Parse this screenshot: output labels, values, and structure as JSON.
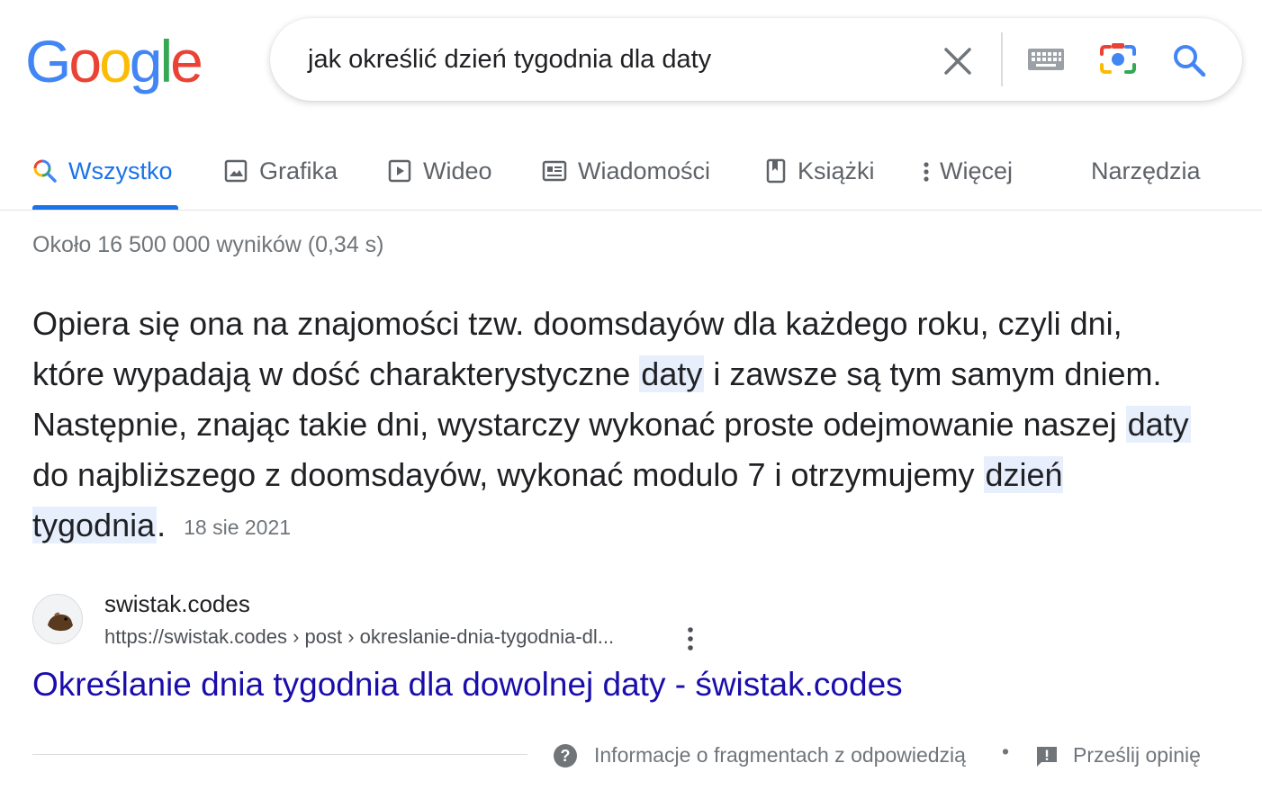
{
  "logo": {
    "letters": [
      "G",
      "o",
      "o",
      "g",
      "l",
      "e"
    ],
    "colors": [
      "#4285f4",
      "#ea4335",
      "#fbbc05",
      "#4285f4",
      "#34a853",
      "#ea4335"
    ]
  },
  "search": {
    "query": "jak określić dzień tygodnia dla daty"
  },
  "tabs": {
    "all": "Wszystko",
    "images": "Grafika",
    "video": "Wideo",
    "news": "Wiadomości",
    "books": "Książki",
    "more": "Więcej",
    "tools": "Narzędzia"
  },
  "colors": {
    "accent": "#1a73e8",
    "link": "#1a0dab",
    "highlight": "#e7effd"
  },
  "stats": "Około 16 500 000 wyników (0,34 s)",
  "snippet": {
    "p1": "Opiera się ona na znajomości tzw. doomsdayów dla każdego roku, czyli dni, które wypadają w dość charakterystyczne ",
    "h1": "daty",
    "p2": " i zawsze są tym samym dniem. Następnie, znając takie dni, wystarczy wykonać proste odejmowanie naszej ",
    "h2": "daty",
    "p3": " do najbliższego z doomsdayów, wykonać modulo 7 i otrzymujemy ",
    "h3": "dzień tygodnia",
    "p4": ".",
    "date": "18 sie 2021"
  },
  "result": {
    "site_name": "swistak.codes",
    "url": "https://swistak.codes › post › okreslanie-dnia-tygodnia-dl...",
    "title": "Określanie dnia tygodnia dla dowolnej daty - świstak.codes"
  },
  "footer": {
    "info": "Informacje o fragmentach z odpowiedzią",
    "separator": "•",
    "feedback": "Prześlij opinię"
  }
}
